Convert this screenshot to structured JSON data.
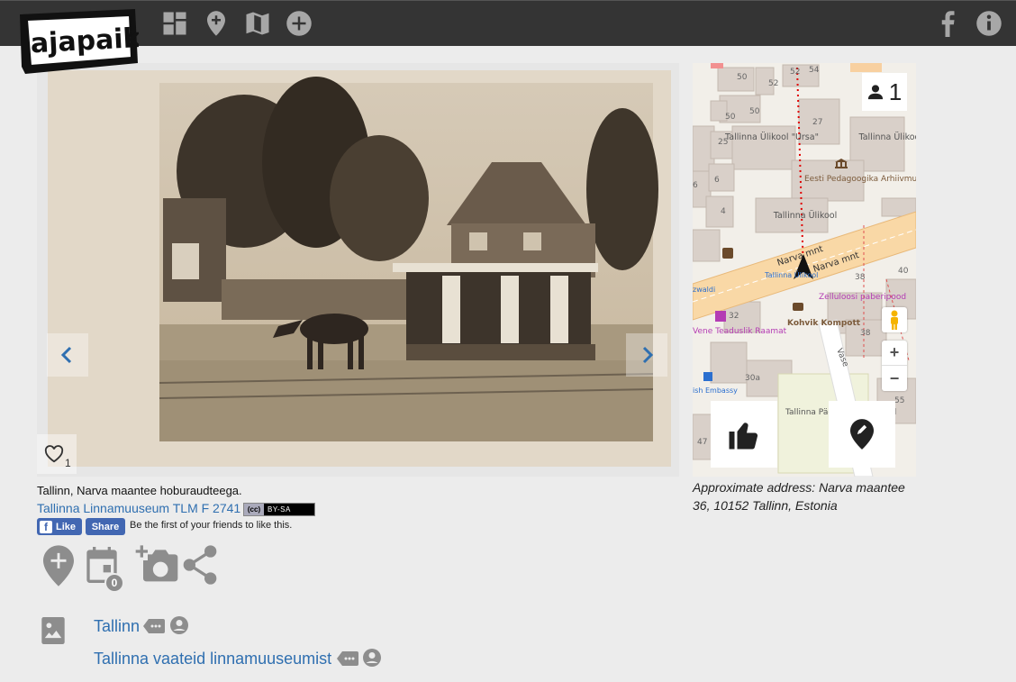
{
  "brand": {
    "logo_text": "ajapaik"
  },
  "nav": {
    "left_icons": [
      "grid-icon",
      "map-pin-icon",
      "map-icon",
      "plus-circle-icon"
    ],
    "right_icons": [
      "facebook-icon",
      "info-icon"
    ]
  },
  "photo": {
    "caption": "Tallinn, Narva maantee hoburaudteega.",
    "source_text": "Tallinna Linnamuuseum TLM F 2741",
    "license": {
      "cc": "(cc)",
      "label": "BY-SA"
    },
    "favorites_count": "1"
  },
  "facebook": {
    "like_label": "Like",
    "share_label": "Share",
    "friends_text": "Be the first of your friends to like this."
  },
  "actions": {
    "rephotos_count": "0",
    "icons": [
      "add-location-icon",
      "calendar-icon",
      "add-photo-icon",
      "share-icon"
    ]
  },
  "albums": [
    {
      "name": "Tallinn"
    },
    {
      "name": "Tallinna vaateid linnamuuseumist"
    }
  ],
  "map": {
    "viewers_count": "1",
    "zoom_in": "+",
    "zoom_out": "−",
    "labels": {
      "street_main": "Narva mnt",
      "university": "Tallinna Ülikool \"Ursa\"",
      "university2": "Tallinna Ülikool",
      "silva": "Tallinna Ülikool \"Silva\"",
      "museum": "Eesti Pedagoogika Arhiivmuuseum",
      "cafe": "Kohvik Kompott",
      "paper": "Zelluloosi paberipood",
      "bookshop": "Vene Teaduslik Raamat",
      "embassy": "ish Embassy",
      "kindergarten": "Tallinna Päevalille Lasteaed",
      "vase": "Vase",
      "stop_left": "zwaldi",
      "stop_right": "Tallinna Ülikool"
    },
    "house_numbers": [
      "50",
      "52",
      "52",
      "54",
      "50",
      "50",
      "27",
      "25",
      "6",
      "6",
      "4",
      "32",
      "38",
      "40",
      "38",
      "30a",
      "47",
      "55"
    ],
    "colors": {
      "road": "#f9d8a6",
      "building": "#d9d0c9",
      "route": "#e00000"
    }
  },
  "address": "Approximate address: Narva maantee 36, 10152 Tallinn, Estonia"
}
